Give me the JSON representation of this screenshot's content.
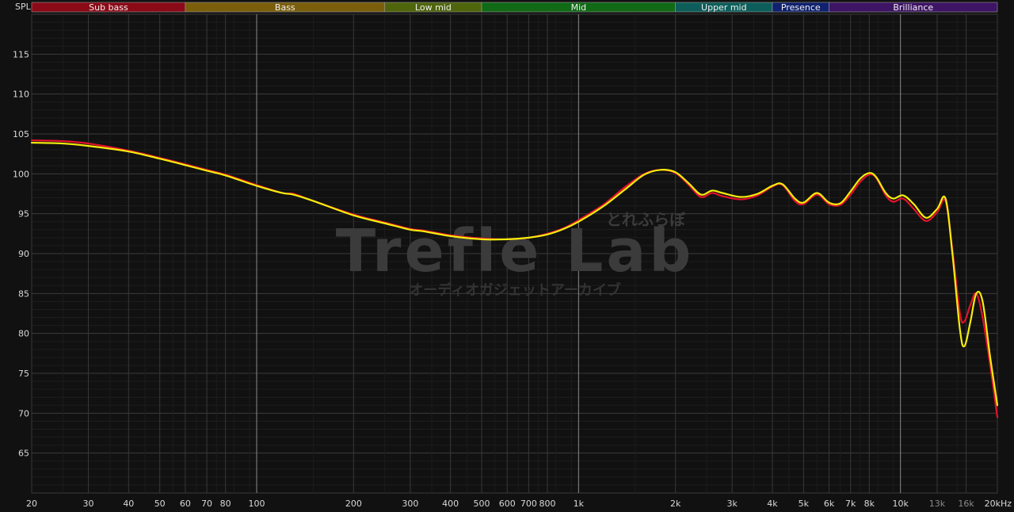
{
  "chart_data": {
    "type": "line",
    "xlabel": "",
    "ylabel": "SPL",
    "x_scale": "log",
    "xlim": [
      20,
      20000
    ],
    "ylim": [
      60,
      120
    ],
    "grid": true,
    "y_ticks": [
      65,
      70,
      75,
      80,
      85,
      90,
      95,
      100,
      105,
      110,
      115
    ],
    "x_ticks": [
      {
        "value": 20,
        "label": "20"
      },
      {
        "value": 30,
        "label": "30"
      },
      {
        "value": 40,
        "label": "40"
      },
      {
        "value": 50,
        "label": "50"
      },
      {
        "value": 60,
        "label": "60"
      },
      {
        "value": 70,
        "label": "70"
      },
      {
        "value": 80,
        "label": "80"
      },
      {
        "value": 100,
        "label": "100"
      },
      {
        "value": 200,
        "label": "200"
      },
      {
        "value": 300,
        "label": "300"
      },
      {
        "value": 400,
        "label": "400"
      },
      {
        "value": 500,
        "label": "500"
      },
      {
        "value": 600,
        "label": "600"
      },
      {
        "value": 700,
        "label": "700"
      },
      {
        "value": 800,
        "label": "800"
      },
      {
        "value": 1000,
        "label": "1k"
      },
      {
        "value": 2000,
        "label": "2k"
      },
      {
        "value": 3000,
        "label": "3k"
      },
      {
        "value": 4000,
        "label": "4k"
      },
      {
        "value": 5000,
        "label": "5k"
      },
      {
        "value": 6000,
        "label": "6k"
      },
      {
        "value": 7000,
        "label": "7k"
      },
      {
        "value": 8000,
        "label": "8k"
      },
      {
        "value": 10000,
        "label": "10k"
      },
      {
        "value": 13000,
        "label": "13k",
        "dim": true
      },
      {
        "value": 16000,
        "label": "16k",
        "dim": true
      },
      {
        "value": 20000,
        "label": "20kHz"
      }
    ],
    "bands": [
      {
        "name": "Sub bass",
        "from": 20,
        "to": 60,
        "color": "#8b0a17"
      },
      {
        "name": "Bass",
        "from": 60,
        "to": 250,
        "color": "#7a5e0c"
      },
      {
        "name": "Low mid",
        "from": 250,
        "to": 500,
        "color": "#4f650c"
      },
      {
        "name": "Mid",
        "from": 500,
        "to": 2000,
        "color": "#106a16"
      },
      {
        "name": "Upper mid",
        "from": 2000,
        "to": 4000,
        "color": "#0d5e5a"
      },
      {
        "name": "Presence",
        "from": 4000,
        "to": 6000,
        "color": "#10216e"
      },
      {
        "name": "Brilliance",
        "from": 6000,
        "to": 20000,
        "color": "#3e1565"
      }
    ],
    "series": [
      {
        "color": "#e3122c",
        "points": [
          [
            20,
            104.2
          ],
          [
            25,
            104.1
          ],
          [
            30,
            103.8
          ],
          [
            40,
            102.9
          ],
          [
            50,
            102.0
          ],
          [
            60,
            101.2
          ],
          [
            70,
            100.5
          ],
          [
            80,
            99.9
          ],
          [
            100,
            98.6
          ],
          [
            120,
            97.6
          ],
          [
            130,
            97.5
          ],
          [
            150,
            96.6
          ],
          [
            200,
            94.9
          ],
          [
            250,
            93.9
          ],
          [
            300,
            93.1
          ],
          [
            330,
            92.9
          ],
          [
            400,
            92.3
          ],
          [
            500,
            91.9
          ],
          [
            600,
            91.8
          ],
          [
            700,
            92.0
          ],
          [
            800,
            92.5
          ],
          [
            900,
            93.2
          ],
          [
            1000,
            94.2
          ],
          [
            1200,
            96.2
          ],
          [
            1400,
            98.4
          ],
          [
            1600,
            100.0
          ],
          [
            1800,
            100.5
          ],
          [
            2000,
            100.1
          ],
          [
            2200,
            98.6
          ],
          [
            2400,
            97.1
          ],
          [
            2600,
            97.6
          ],
          [
            2800,
            97.2
          ],
          [
            3200,
            96.8
          ],
          [
            3600,
            97.3
          ],
          [
            4000,
            98.4
          ],
          [
            4300,
            98.6
          ],
          [
            4700,
            96.6
          ],
          [
            5000,
            96.2
          ],
          [
            5500,
            97.4
          ],
          [
            6000,
            96.2
          ],
          [
            6500,
            96.1
          ],
          [
            7000,
            97.4
          ],
          [
            7500,
            99.0
          ],
          [
            8000,
            99.9
          ],
          [
            8400,
            99.5
          ],
          [
            9000,
            97.3
          ],
          [
            9500,
            96.5
          ],
          [
            10200,
            96.9
          ],
          [
            11000,
            95.6
          ],
          [
            12000,
            94.1
          ],
          [
            13000,
            95.2
          ],
          [
            13800,
            96.6
          ],
          [
            14500,
            90.5
          ],
          [
            15300,
            82.5
          ],
          [
            15800,
            81.5
          ],
          [
            16500,
            83.6
          ],
          [
            17200,
            85.0
          ],
          [
            18000,
            82.0
          ],
          [
            19000,
            76.0
          ],
          [
            20000,
            69.5
          ]
        ]
      },
      {
        "color": "#f5ed0c",
        "points": [
          [
            20,
            103.9
          ],
          [
            25,
            103.8
          ],
          [
            30,
            103.5
          ],
          [
            40,
            102.8
          ],
          [
            50,
            101.9
          ],
          [
            60,
            101.1
          ],
          [
            70,
            100.4
          ],
          [
            80,
            99.8
          ],
          [
            100,
            98.5
          ],
          [
            120,
            97.6
          ],
          [
            130,
            97.4
          ],
          [
            150,
            96.6
          ],
          [
            200,
            94.8
          ],
          [
            250,
            93.8
          ],
          [
            300,
            93.0
          ],
          [
            330,
            92.8
          ],
          [
            400,
            92.2
          ],
          [
            500,
            91.8
          ],
          [
            600,
            91.8
          ],
          [
            700,
            92.0
          ],
          [
            800,
            92.4
          ],
          [
            900,
            93.1
          ],
          [
            1000,
            94.0
          ],
          [
            1200,
            96.0
          ],
          [
            1400,
            98.1
          ],
          [
            1600,
            99.9
          ],
          [
            1800,
            100.5
          ],
          [
            2000,
            100.2
          ],
          [
            2200,
            98.8
          ],
          [
            2400,
            97.4
          ],
          [
            2600,
            97.9
          ],
          [
            2800,
            97.6
          ],
          [
            3200,
            97.1
          ],
          [
            3600,
            97.5
          ],
          [
            4000,
            98.5
          ],
          [
            4300,
            98.7
          ],
          [
            4700,
            96.9
          ],
          [
            5000,
            96.4
          ],
          [
            5500,
            97.6
          ],
          [
            6000,
            96.4
          ],
          [
            6500,
            96.3
          ],
          [
            7000,
            97.8
          ],
          [
            7500,
            99.4
          ],
          [
            8000,
            100.1
          ],
          [
            8400,
            99.6
          ],
          [
            9000,
            97.6
          ],
          [
            9500,
            96.9
          ],
          [
            10200,
            97.3
          ],
          [
            11000,
            96.2
          ],
          [
            12000,
            94.5
          ],
          [
            13000,
            95.6
          ],
          [
            13800,
            96.9
          ],
          [
            14500,
            90.0
          ],
          [
            15300,
            80.5
          ],
          [
            15800,
            78.4
          ],
          [
            16500,
            81.5
          ],
          [
            17200,
            85.0
          ],
          [
            18000,
            84.0
          ],
          [
            19000,
            77.0
          ],
          [
            20000,
            71.0
          ]
        ]
      }
    ]
  },
  "watermark": {
    "title": "Trefle Lab",
    "kana_top": "とれふらぼ",
    "subtitle": "オーディオガジェットアーカイブ"
  }
}
